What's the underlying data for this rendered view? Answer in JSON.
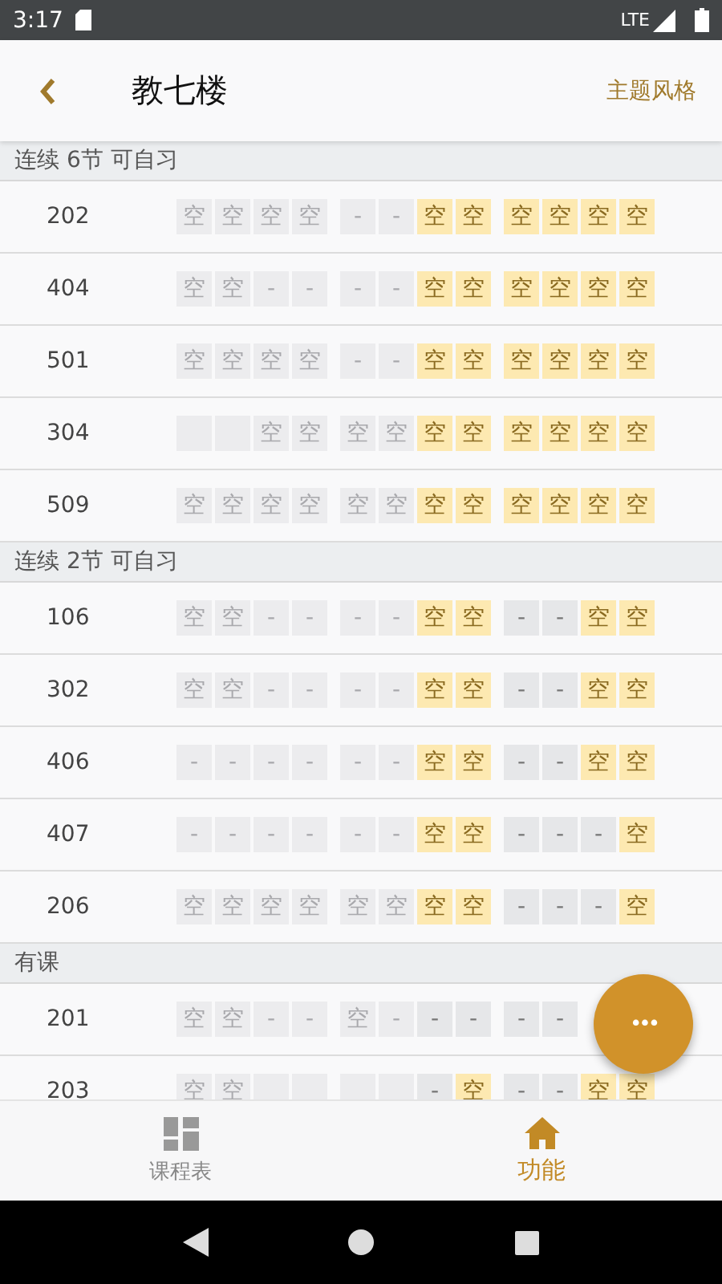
{
  "status_bar": {
    "time": "3:17",
    "network": "LTE"
  },
  "header": {
    "title": "教七楼",
    "action": "主题风格"
  },
  "sections": [
    {
      "title": "连续 6节 可自习",
      "rooms": [
        {
          "room": "202",
          "cells": [
            {
              "kind": "free",
              "past": true,
              "text": "空"
            },
            {
              "kind": "free",
              "past": true,
              "text": "空"
            },
            {
              "kind": "free",
              "past": true,
              "text": "空"
            },
            {
              "kind": "free",
              "past": true,
              "text": "空"
            },
            {
              "kind": "busy",
              "past": true,
              "text": "-"
            },
            {
              "kind": "busy",
              "past": true,
              "text": "-"
            },
            {
              "kind": "free",
              "past": false,
              "text": "空"
            },
            {
              "kind": "free",
              "past": false,
              "text": "空"
            },
            {
              "kind": "free",
              "past": false,
              "text": "空"
            },
            {
              "kind": "free",
              "past": false,
              "text": "空"
            },
            {
              "kind": "free",
              "past": false,
              "text": "空"
            },
            {
              "kind": "free",
              "past": false,
              "text": "空"
            }
          ]
        },
        {
          "room": "404",
          "cells": [
            {
              "kind": "free",
              "past": true,
              "text": "空"
            },
            {
              "kind": "free",
              "past": true,
              "text": "空"
            },
            {
              "kind": "busy",
              "past": true,
              "text": "-"
            },
            {
              "kind": "busy",
              "past": true,
              "text": "-"
            },
            {
              "kind": "busy",
              "past": true,
              "text": "-"
            },
            {
              "kind": "busy",
              "past": true,
              "text": "-"
            },
            {
              "kind": "free",
              "past": false,
              "text": "空"
            },
            {
              "kind": "free",
              "past": false,
              "text": "空"
            },
            {
              "kind": "free",
              "past": false,
              "text": "空"
            },
            {
              "kind": "free",
              "past": false,
              "text": "空"
            },
            {
              "kind": "free",
              "past": false,
              "text": "空"
            },
            {
              "kind": "free",
              "past": false,
              "text": "空"
            }
          ]
        },
        {
          "room": "501",
          "cells": [
            {
              "kind": "free",
              "past": true,
              "text": "空"
            },
            {
              "kind": "free",
              "past": true,
              "text": "空"
            },
            {
              "kind": "free",
              "past": true,
              "text": "空"
            },
            {
              "kind": "free",
              "past": true,
              "text": "空"
            },
            {
              "kind": "busy",
              "past": true,
              "text": "-"
            },
            {
              "kind": "busy",
              "past": true,
              "text": "-"
            },
            {
              "kind": "free",
              "past": false,
              "text": "空"
            },
            {
              "kind": "free",
              "past": false,
              "text": "空"
            },
            {
              "kind": "free",
              "past": false,
              "text": "空"
            },
            {
              "kind": "free",
              "past": false,
              "text": "空"
            },
            {
              "kind": "free",
              "past": false,
              "text": "空"
            },
            {
              "kind": "free",
              "past": false,
              "text": "空"
            }
          ]
        },
        {
          "room": "304",
          "cells": [
            {
              "kind": "blank",
              "past": true
            },
            {
              "kind": "blank",
              "past": true
            },
            {
              "kind": "free",
              "past": true,
              "text": "空"
            },
            {
              "kind": "free",
              "past": true,
              "text": "空"
            },
            {
              "kind": "free",
              "past": true,
              "text": "空"
            },
            {
              "kind": "free",
              "past": true,
              "text": "空"
            },
            {
              "kind": "free",
              "past": false,
              "text": "空"
            },
            {
              "kind": "free",
              "past": false,
              "text": "空"
            },
            {
              "kind": "free",
              "past": false,
              "text": "空"
            },
            {
              "kind": "free",
              "past": false,
              "text": "空"
            },
            {
              "kind": "free",
              "past": false,
              "text": "空"
            },
            {
              "kind": "free",
              "past": false,
              "text": "空"
            }
          ]
        },
        {
          "room": "509",
          "cells": [
            {
              "kind": "free",
              "past": true,
              "text": "空"
            },
            {
              "kind": "free",
              "past": true,
              "text": "空"
            },
            {
              "kind": "free",
              "past": true,
              "text": "空"
            },
            {
              "kind": "free",
              "past": true,
              "text": "空"
            },
            {
              "kind": "free",
              "past": true,
              "text": "空"
            },
            {
              "kind": "free",
              "past": true,
              "text": "空"
            },
            {
              "kind": "free",
              "past": false,
              "text": "空"
            },
            {
              "kind": "free",
              "past": false,
              "text": "空"
            },
            {
              "kind": "free",
              "past": false,
              "text": "空"
            },
            {
              "kind": "free",
              "past": false,
              "text": "空"
            },
            {
              "kind": "free",
              "past": false,
              "text": "空"
            },
            {
              "kind": "free",
              "past": false,
              "text": "空"
            }
          ]
        }
      ]
    },
    {
      "title": "连续 2节 可自习",
      "rooms": [
        {
          "room": "106",
          "cells": [
            {
              "kind": "free",
              "past": true,
              "text": "空"
            },
            {
              "kind": "free",
              "past": true,
              "text": "空"
            },
            {
              "kind": "busy",
              "past": true,
              "text": "-"
            },
            {
              "kind": "busy",
              "past": true,
              "text": "-"
            },
            {
              "kind": "busy",
              "past": true,
              "text": "-"
            },
            {
              "kind": "busy",
              "past": true,
              "text": "-"
            },
            {
              "kind": "free",
              "past": false,
              "text": "空"
            },
            {
              "kind": "free",
              "past": false,
              "text": "空"
            },
            {
              "kind": "busy",
              "past": false,
              "text": "-"
            },
            {
              "kind": "busy",
              "past": false,
              "text": "-"
            },
            {
              "kind": "free",
              "past": false,
              "text": "空"
            },
            {
              "kind": "free",
              "past": false,
              "text": "空"
            }
          ]
        },
        {
          "room": "302",
          "cells": [
            {
              "kind": "free",
              "past": true,
              "text": "空"
            },
            {
              "kind": "free",
              "past": true,
              "text": "空"
            },
            {
              "kind": "busy",
              "past": true,
              "text": "-"
            },
            {
              "kind": "busy",
              "past": true,
              "text": "-"
            },
            {
              "kind": "busy",
              "past": true,
              "text": "-"
            },
            {
              "kind": "busy",
              "past": true,
              "text": "-"
            },
            {
              "kind": "free",
              "past": false,
              "text": "空"
            },
            {
              "kind": "free",
              "past": false,
              "text": "空"
            },
            {
              "kind": "busy",
              "past": false,
              "text": "-"
            },
            {
              "kind": "busy",
              "past": false,
              "text": "-"
            },
            {
              "kind": "free",
              "past": false,
              "text": "空"
            },
            {
              "kind": "free",
              "past": false,
              "text": "空"
            }
          ]
        },
        {
          "room": "406",
          "cells": [
            {
              "kind": "busy",
              "past": true,
              "text": "-"
            },
            {
              "kind": "busy",
              "past": true,
              "text": "-"
            },
            {
              "kind": "busy",
              "past": true,
              "text": "-"
            },
            {
              "kind": "busy",
              "past": true,
              "text": "-"
            },
            {
              "kind": "busy",
              "past": true,
              "text": "-"
            },
            {
              "kind": "busy",
              "past": true,
              "text": "-"
            },
            {
              "kind": "free",
              "past": false,
              "text": "空"
            },
            {
              "kind": "free",
              "past": false,
              "text": "空"
            },
            {
              "kind": "busy",
              "past": false,
              "text": "-"
            },
            {
              "kind": "busy",
              "past": false,
              "text": "-"
            },
            {
              "kind": "free",
              "past": false,
              "text": "空"
            },
            {
              "kind": "free",
              "past": false,
              "text": "空"
            }
          ]
        },
        {
          "room": "407",
          "cells": [
            {
              "kind": "busy",
              "past": true,
              "text": "-"
            },
            {
              "kind": "busy",
              "past": true,
              "text": "-"
            },
            {
              "kind": "busy",
              "past": true,
              "text": "-"
            },
            {
              "kind": "busy",
              "past": true,
              "text": "-"
            },
            {
              "kind": "busy",
              "past": true,
              "text": "-"
            },
            {
              "kind": "busy",
              "past": true,
              "text": "-"
            },
            {
              "kind": "free",
              "past": false,
              "text": "空"
            },
            {
              "kind": "free",
              "past": false,
              "text": "空"
            },
            {
              "kind": "busy",
              "past": false,
              "text": "-"
            },
            {
              "kind": "busy",
              "past": false,
              "text": "-"
            },
            {
              "kind": "busy",
              "past": false,
              "text": "-"
            },
            {
              "kind": "free",
              "past": false,
              "text": "空"
            }
          ]
        },
        {
          "room": "206",
          "cells": [
            {
              "kind": "free",
              "past": true,
              "text": "空"
            },
            {
              "kind": "free",
              "past": true,
              "text": "空"
            },
            {
              "kind": "free",
              "past": true,
              "text": "空"
            },
            {
              "kind": "free",
              "past": true,
              "text": "空"
            },
            {
              "kind": "free",
              "past": true,
              "text": "空"
            },
            {
              "kind": "free",
              "past": true,
              "text": "空"
            },
            {
              "kind": "free",
              "past": false,
              "text": "空"
            },
            {
              "kind": "free",
              "past": false,
              "text": "空"
            },
            {
              "kind": "busy",
              "past": false,
              "text": "-"
            },
            {
              "kind": "busy",
              "past": false,
              "text": "-"
            },
            {
              "kind": "busy",
              "past": false,
              "text": "-"
            },
            {
              "kind": "free",
              "past": false,
              "text": "空"
            }
          ]
        }
      ]
    },
    {
      "title": "有课",
      "rooms": [
        {
          "room": "201",
          "cells": [
            {
              "kind": "free",
              "past": true,
              "text": "空"
            },
            {
              "kind": "free",
              "past": true,
              "text": "空"
            },
            {
              "kind": "busy",
              "past": true,
              "text": "-"
            },
            {
              "kind": "busy",
              "past": true,
              "text": "-"
            },
            {
              "kind": "free",
              "past": true,
              "text": "空"
            },
            {
              "kind": "busy",
              "past": true,
              "text": "-"
            },
            {
              "kind": "busy",
              "past": false,
              "text": "-"
            },
            {
              "kind": "busy",
              "past": false,
              "text": "-"
            },
            {
              "kind": "busy",
              "past": false,
              "text": "-"
            },
            {
              "kind": "busy",
              "past": false,
              "text": "-"
            }
          ]
        },
        {
          "room": "203",
          "cells": [
            {
              "kind": "free",
              "past": true,
              "text": "空"
            },
            {
              "kind": "free",
              "past": true,
              "text": "空"
            },
            {
              "kind": "blank",
              "past": true
            },
            {
              "kind": "blank",
              "past": true
            },
            {
              "kind": "blank",
              "past": true
            },
            {
              "kind": "blank",
              "past": true
            },
            {
              "kind": "busy",
              "past": false,
              "text": "-"
            },
            {
              "kind": "free",
              "past": false,
              "text": "空"
            },
            {
              "kind": "busy",
              "past": false,
              "text": "-"
            },
            {
              "kind": "busy",
              "past": false,
              "text": "-"
            },
            {
              "kind": "free",
              "past": false,
              "text": "空"
            },
            {
              "kind": "free",
              "past": false,
              "text": "空"
            }
          ]
        }
      ]
    }
  ],
  "fab": {
    "label": "•••"
  },
  "tabs": [
    {
      "label": "课程表",
      "selected": false
    },
    {
      "label": "功能",
      "selected": true
    }
  ]
}
